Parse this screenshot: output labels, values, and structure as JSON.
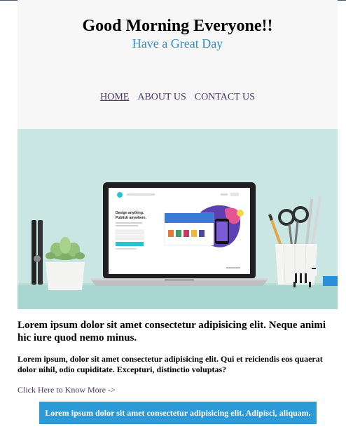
{
  "header": {
    "title": "Good Morning Everyone!!",
    "tagline": "Have a Great Day"
  },
  "nav": {
    "items": [
      {
        "label": "HOME",
        "active": true
      },
      {
        "label": "ABOUT US",
        "active": false
      },
      {
        "label": "CONTACT US",
        "active": false
      }
    ]
  },
  "hero": {
    "screen_headline": "Design anything.\nPublish anywhere."
  },
  "content": {
    "headline": "Lorem ipsum dolor sit amet consectetur adipisicing elit. Neque animi hic iure quod nemo minus.",
    "paragraph": "Lorem ipsum, dolor sit amet consectetur adipisicing elit. Qui et reiciendis eos quaerat dolor nihil, odio cupiditate. Excepturi, distinctio voluptas?",
    "link": "Click Here to Know More ->"
  },
  "cta": {
    "label": "Lorem ipsum dolor sit amet consectetur adipisicing elit. Adipisci, aliquam."
  },
  "colors": {
    "header_bg": "#f7f7f7",
    "tagline": "#2b8fc4",
    "nav_link": "#4a3567",
    "hero_bg": "#c9e6e2",
    "cta_bg": "#2d9ad8"
  }
}
